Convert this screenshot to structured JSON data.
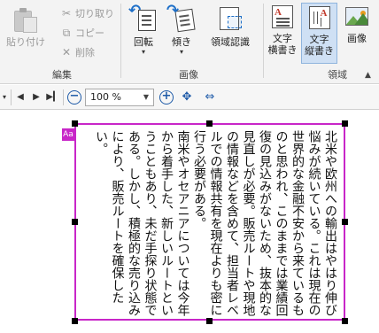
{
  "ribbon": {
    "clipboard": {
      "label": "編集",
      "paste": "貼り付け",
      "cut": "切り取り",
      "copy": "コピー",
      "delete": "削除"
    },
    "image": {
      "label": "画像",
      "rotate": "回転",
      "tilt": "傾き",
      "region_recognition": "領域認識"
    },
    "region": {
      "label": "領域",
      "text_horizontal": [
        "文字",
        "横書き"
      ],
      "text_vertical": [
        "文字",
        "縦書き"
      ],
      "image": "画像"
    }
  },
  "toolbar": {
    "zoom_value": "100 %"
  },
  "document": {
    "tag": "Aa",
    "paragraphs": [
      "北米や欧州への輸出はやはり伸び悩みが続いている。これは現在の世界的な金融不安から来ているものと思われ、このままでは業績回復の見込みがないため、抜本的な見直しが必要。販売ルートや現地の情報などを含めて、担当者レベルでの情報共有を現在よりも密に行う必要がある。",
      "南米やオセアニアについては今年から着手した、新しいルートということもあり、未だ手探り状態である。しかし、積極的な売り込みにより、販売ルートを確保したい。"
    ]
  },
  "colors": {
    "selection_border": "#c826c8",
    "accent": "#1e6fc8",
    "ribbon_bg": "#f3f3f3"
  }
}
